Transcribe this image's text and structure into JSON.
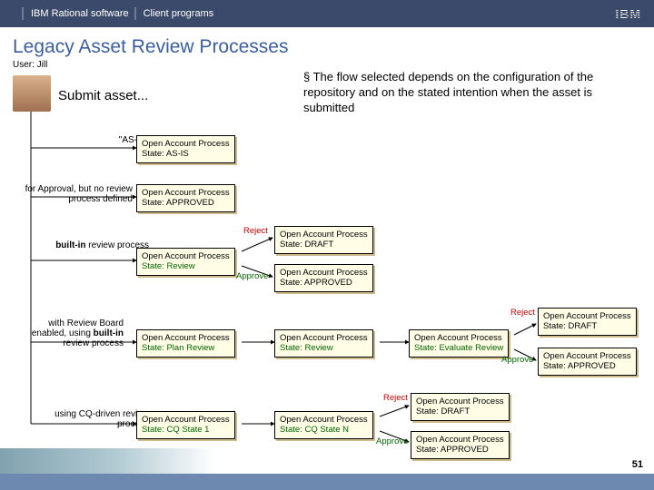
{
  "topbar": {
    "left": "IBM Rational software",
    "right": "Client programs",
    "logo": "IBM"
  },
  "title": "Legacy Asset Review Processes",
  "user_label": "User: Jill",
  "bullet": "The flow selected depends on the configuration of the repository and on the stated intention when the asset is submitted",
  "submit": "Submit asset...",
  "rows": {
    "asis": {
      "label": "\"AS-IS\"",
      "node": {
        "title": "Open Account Process",
        "state": "State: AS-IS"
      }
    },
    "approval": {
      "label": "for Approval, but no review process defined",
      "node": {
        "title": "Open Account Process",
        "state": "State: APPROVED"
      }
    },
    "builtin": {
      "label_strong": "built-in",
      "label_rest": " review process",
      "node1": {
        "title": "Open Account Process",
        "state": "State: Review"
      },
      "reject": {
        "title": "Open Account Process",
        "state": "State: DRAFT"
      },
      "approve": {
        "title": "Open Account Process",
        "state": "State: APPROVED"
      }
    },
    "board": {
      "label_top": "with Review Board enabled, using ",
      "label_strong": "built-in",
      "label_bottom": " review process",
      "node1": {
        "title": "Open Account Process",
        "state": "State: Plan Review"
      },
      "node2": {
        "title": "Open Account Process",
        "state": "State: Review"
      },
      "node3": {
        "title": "Open Account Process",
        "state": "State: Evaluate Review"
      },
      "reject": {
        "title": "Open Account Process",
        "state": "State: DRAFT"
      },
      "approve": {
        "title": "Open Account Process",
        "state": "State: APPROVED"
      }
    },
    "cq": {
      "label": "using CQ-driven review process",
      "node1": {
        "title": "Open Account Process",
        "state": "State: CQ State 1"
      },
      "node2": {
        "title": "Open Account Process",
        "state": "State: CQ State N"
      },
      "reject": {
        "title": "Open Account Process",
        "state": "State: DRAFT"
      },
      "approve": {
        "title": "Open Account Process",
        "state": "State: APPROVED"
      }
    }
  },
  "edge_labels": {
    "reject": "Reject",
    "approve": "Approve"
  },
  "page_number": "51"
}
